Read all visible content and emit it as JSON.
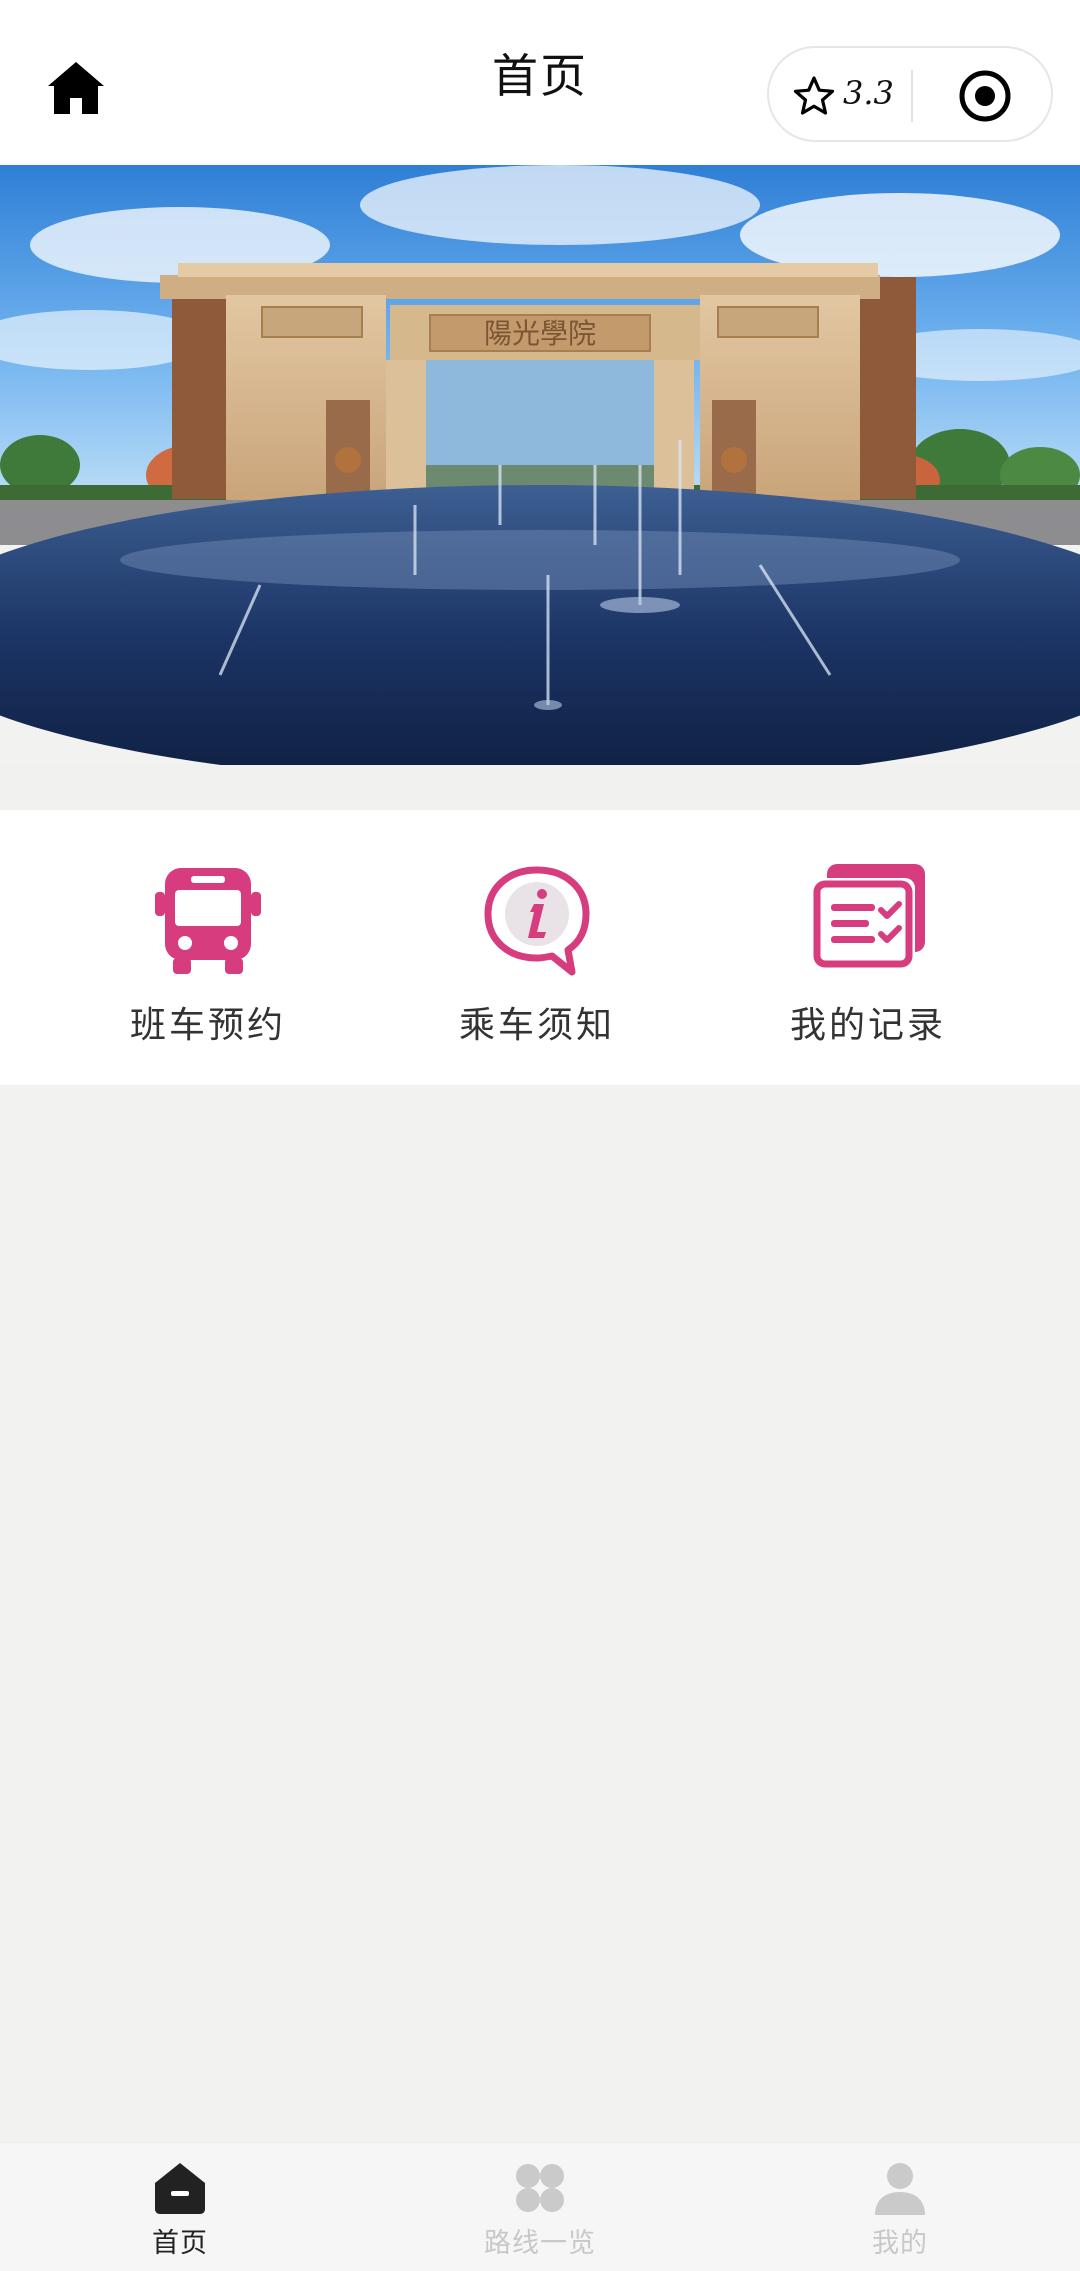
{
  "header": {
    "title": "首页",
    "home_icon": "home-icon",
    "capsule": {
      "rating": "3.3",
      "star_icon": "star-outline-icon",
      "target_icon": "target-icon"
    }
  },
  "banner": {
    "gate_inscription": "陽光學院",
    "description_icon": "campus-gate-photo"
  },
  "menu": {
    "items": [
      {
        "label": "班车预约",
        "icon": "bus-icon"
      },
      {
        "label": "乘车须知",
        "icon": "info-bubble-icon"
      },
      {
        "label": "我的记录",
        "icon": "records-icon"
      }
    ]
  },
  "tabbar": {
    "items": [
      {
        "label": "首页",
        "icon": "home-icon",
        "active": true
      },
      {
        "label": "路线一览",
        "icon": "grid-icon",
        "active": false
      },
      {
        "label": "我的",
        "icon": "user-icon",
        "active": false
      }
    ]
  },
  "colors": {
    "accent": "#d63c7e",
    "header_bg": "#ffffff",
    "page_bg": "#f2f2f1",
    "tab_active": "#222222",
    "tab_inactive": "#c8c8c8"
  }
}
